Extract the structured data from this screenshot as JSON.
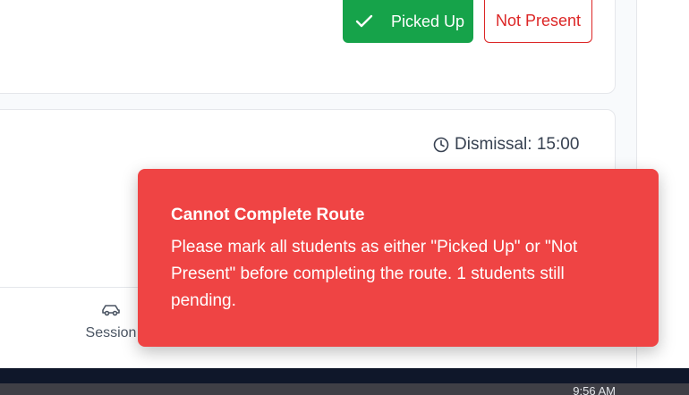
{
  "student_actions": {
    "picked_up_label": "Picked Up",
    "not_present_label": "Not Present"
  },
  "student_card": {
    "dismissal_text": "Dismissal: 15:00"
  },
  "bottom_nav": {
    "sessions_label": "Session",
    "sessions_icon": "car-icon"
  },
  "toast": {
    "title": "Cannot Complete Route",
    "message": "Please mark all students as either \"Picked Up\" or \"Not Present\" before completing the route. 1 students still pending."
  },
  "taskbar": {
    "time": "9:56 AM"
  },
  "colors": {
    "picked_up": "#16a34a",
    "not_present": "#dc2626",
    "toast_bg": "#ef4444"
  }
}
